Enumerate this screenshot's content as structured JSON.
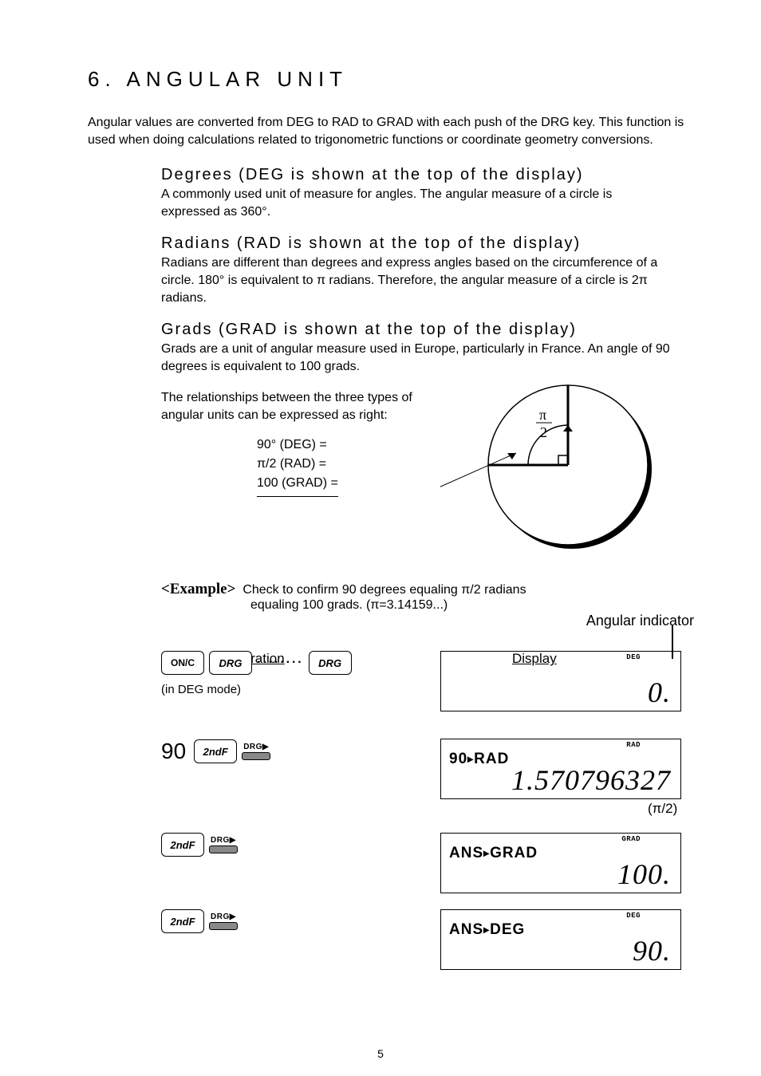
{
  "section_title": "6. ANGULAR UNIT",
  "intro": "Angular values are converted from DEG to RAD to GRAD with each push of the DRG key. This function is used when doing calculations related to trigonometric functions or coordinate geometry conversions.",
  "defs": {
    "degrees": {
      "heading": "Degrees (DEG is shown at the top of the display)",
      "body": "A commonly used unit of measure for angles. The angular measure of a circle is expressed as 360°."
    },
    "radians": {
      "heading": "Radians (RAD is shown at the top of the display)",
      "body": "Radians are different than degrees and express angles based on the circumference of a circle. 180° is equivalent to π radians. Therefore, the angular measure of a circle is 2π radians."
    },
    "grads": {
      "heading": "Grads (GRAD is shown at the top of the display)",
      "body": "Grads are a unit of angular measure used in Europe, particularly in France.  An angle of 90 degrees is equivalent to 100 grads."
    }
  },
  "relationship": {
    "text": "The relationships between the three types of angular units can be expressed as right:",
    "eq1": "90° (DEG) =",
    "eq2": "π/2 (RAD) =",
    "eq3": "100 (GRAD) =",
    "diagram_label": "π\n2"
  },
  "example": {
    "tag": "<Example>",
    "line1": "Check to confirm 90 degrees equaling π/2 radians",
    "line2": "equaling 100 grads. (π=3.14159...)"
  },
  "angular_indicator_label": "Angular indicator",
  "columns": {
    "op": "Operation",
    "dp": "Display"
  },
  "keys": {
    "onc": "ON/C",
    "drg": "DRG",
    "secondf": "2ndF",
    "drg_arrow": "DRG▶"
  },
  "rows": {
    "r1": {
      "sub": "(in DEG mode)",
      "lcd": {
        "mode": "DEG",
        "line1": "",
        "big": "0."
      }
    },
    "r2": {
      "ninety": "90",
      "lcd": {
        "mode": "RAD",
        "line1_a": "90",
        "line1_b": "RAD",
        "big": "1.570796327"
      },
      "note": "(π/2)"
    },
    "r3": {
      "lcd": {
        "mode": "GRAD",
        "line1_a": "ANS",
        "line1_b": "GRAD",
        "big": "100."
      }
    },
    "r4": {
      "lcd": {
        "mode": "DEG",
        "line1_a": "ANS",
        "line1_b": "DEG",
        "big": "90."
      }
    }
  },
  "page_number": "5"
}
